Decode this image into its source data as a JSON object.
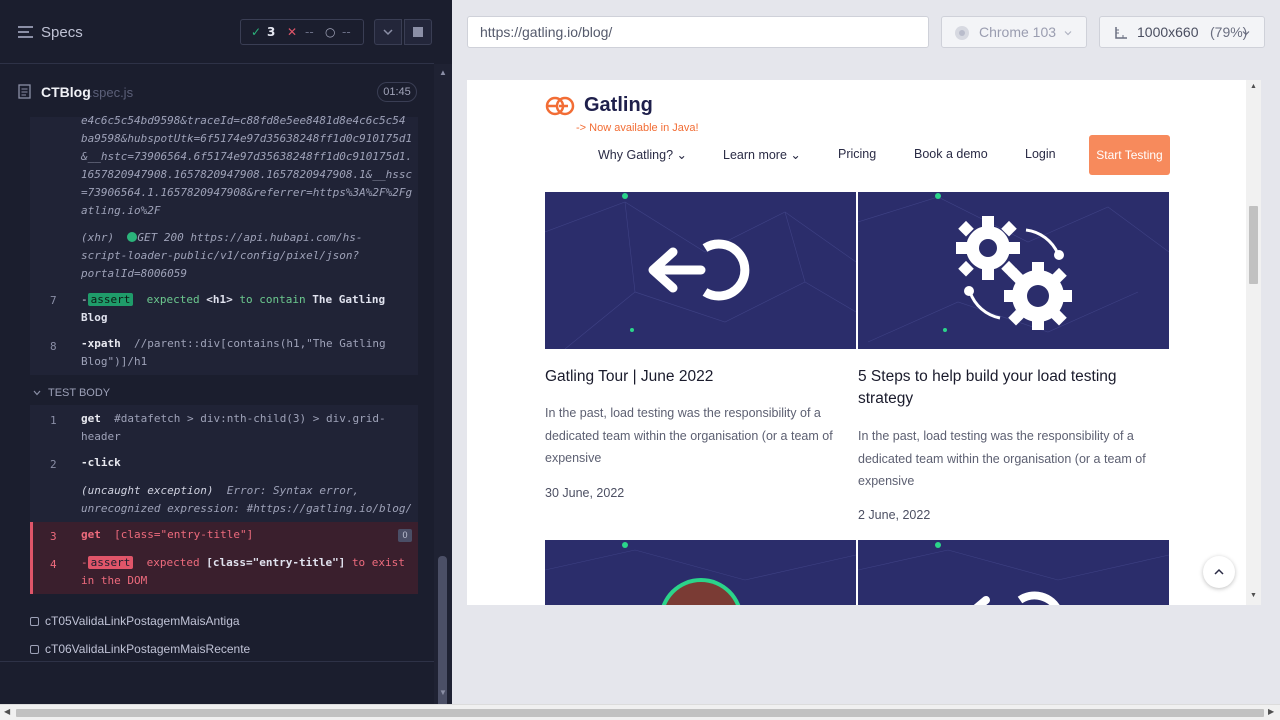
{
  "left": {
    "title": "Specs",
    "stats": {
      "passed": "3",
      "failed": "--",
      "pending": "--"
    },
    "file": {
      "name": "CTBlog",
      "ext": ".spec.js",
      "duration": "01:45"
    },
    "log_top": [
      "e4c6c5c54bd9598&traceId=c88fd8e5ee8481d8e4c6c5c54",
      "ba9598&hubspotUtk=6f5174e97d35638248ff1d0c910175d1",
      "&__hstc=73906564.6f5174e97d35638248ff1d0c910175d1.",
      "1657820947908.1657820947908.1657820947908.1&__hssc",
      "=73906564.1.1657820947908&referrer=https%3A%2F%2Fg",
      "atling.io%2F"
    ],
    "xhr": {
      "label": "(xhr)",
      "text": "GET 200 https://api.hubapi.com/hs-",
      "line2": "script-loader-public/v1/config/pixel/json?",
      "line3": "portalId=8006059"
    },
    "cmd7": {
      "num": "7",
      "dash": "-",
      "badge": "assert",
      "expected": "expected",
      "tag": "<h1>",
      "contain": "to contain",
      "value": "The Gatling",
      "value2": "Blog"
    },
    "cmd8": {
      "num": "8",
      "name": "-xpath",
      "arg": "//parent::div[contains(h1,\"The Gatling",
      "arg2": "Blog\")]/h1"
    },
    "test_body": "TEST BODY",
    "body1": {
      "num": "1",
      "name": "get",
      "arg": "#datafetch > div:nth-child(3) > div.grid-",
      "arg2": "header"
    },
    "body2": {
      "num": "2",
      "name": "-click"
    },
    "exception": {
      "label": "(uncaught exception)",
      "text": "Error: Syntax error,",
      "line2": "unrecognized expression: #https://gatling.io/blog/"
    },
    "body3": {
      "num": "3",
      "name": "get",
      "arg": "[class=\"entry-title\"]",
      "pin": "0"
    },
    "body4": {
      "num": "4",
      "dash": "-",
      "badge": "assert",
      "expected": "expected",
      "sel": "[class=\"entry-title\"]",
      "exist": "to exist",
      "line2": "in the DOM"
    },
    "tests": [
      "cT05ValidaLinkPostagemMaisAntiga",
      "cT06ValidaLinkPostagemMaisRecente"
    ]
  },
  "right": {
    "url": "https://gatling.io/blog/",
    "browser": "Chrome 103",
    "viewport": "1000x660",
    "scale": "(79%)"
  },
  "site": {
    "logo": "Gatling",
    "tagline": "-> Now available in Java!",
    "nav": [
      "Why Gatling?",
      "Learn more",
      "Pricing",
      "Book a demo",
      "Login"
    ],
    "cta": "Start Testing",
    "cards": [
      {
        "title": "Gatling Tour | June 2022",
        "desc": [
          "In the past, load testing was the responsibility of a",
          "dedicated team within the organisation (or a team of",
          "expensive"
        ],
        "date": "30 June, 2022"
      },
      {
        "title": "5 Steps to help build your load testing",
        "title2": "strategy",
        "desc": [
          "In the past, load testing was the responsibility of a",
          "dedicated team within the organisation (or a team of",
          "expensive"
        ],
        "date": "2 June, 2022"
      }
    ]
  },
  "colors": {
    "panel_bg": "#1b1e2e",
    "accent_green": "#1f9c6a",
    "accent_red": "#e05569",
    "brand_orange": "#f78a5c",
    "card_navy": "#2b2d6b"
  }
}
